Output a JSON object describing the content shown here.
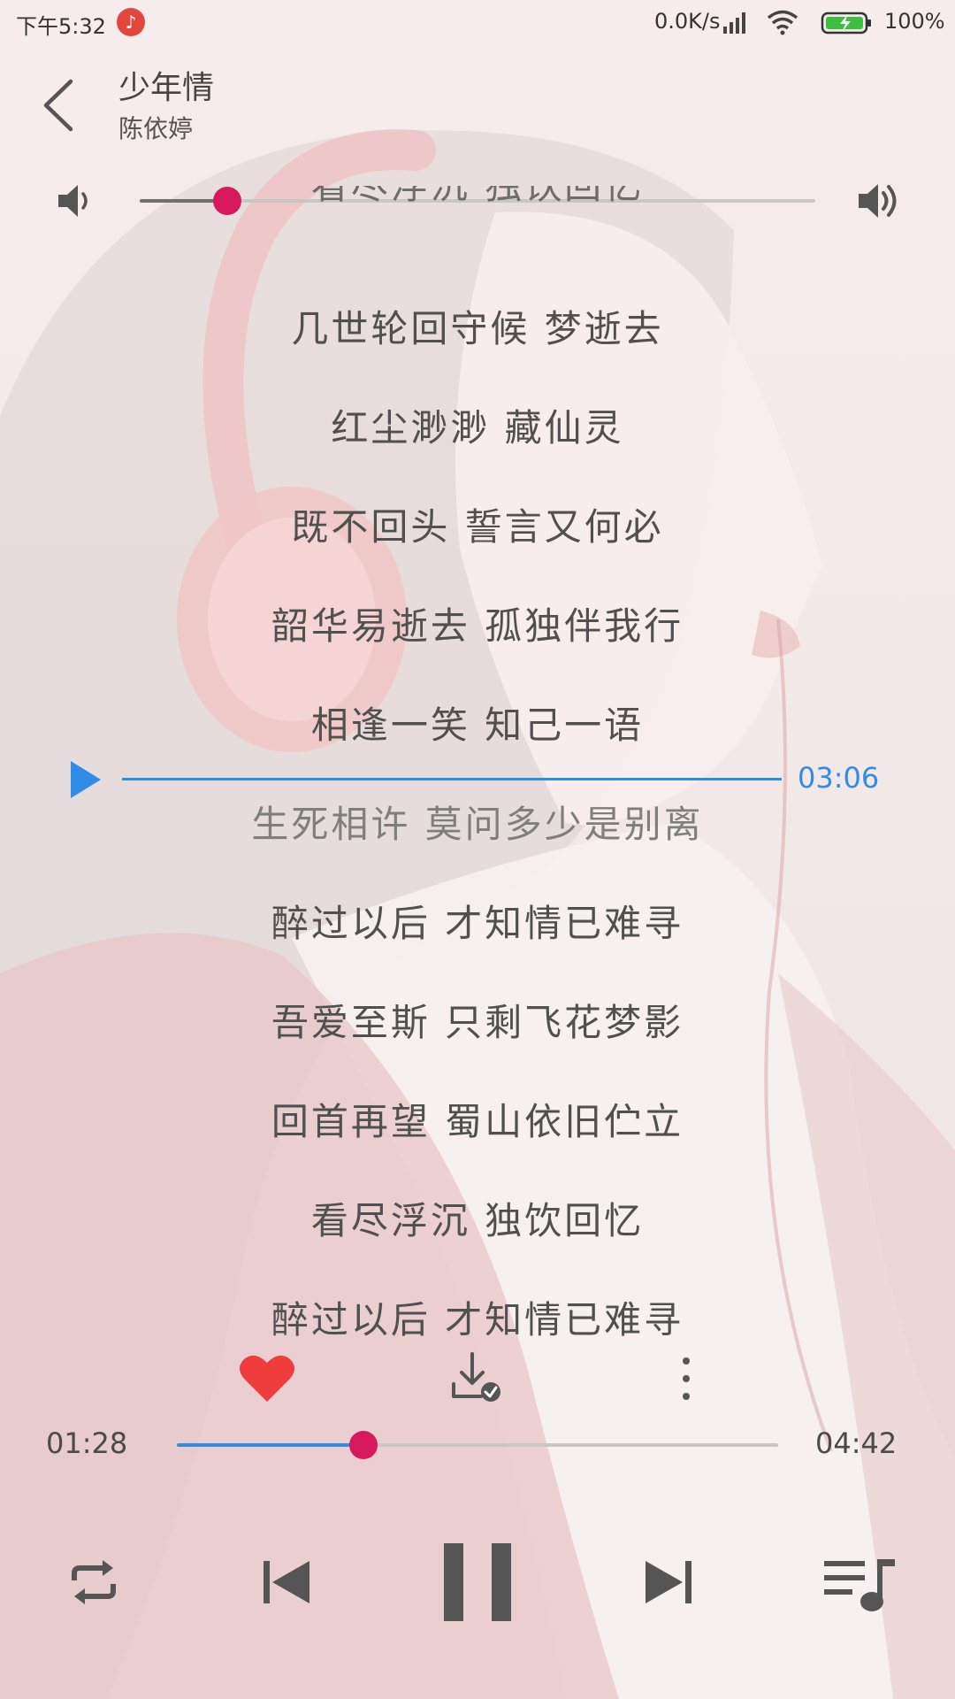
{
  "status_bar": {
    "time": "下午5:32",
    "app_icon": "music-note-icon",
    "net_speed": "0.0K/s",
    "battery": "100%",
    "icons": [
      "signal-icon",
      "wifi-icon",
      "battery-charging-icon"
    ]
  },
  "header": {
    "title": "少年情",
    "artist": "陈依婷"
  },
  "volume": {
    "level": 0.13
  },
  "lyrics": {
    "lines": [
      "看尽浮沉 独饮回忆",
      "几世轮回守候 梦逝去",
      "红尘渺渺 藏仙灵",
      "既不回头 誓言又何必",
      "韶华易逝去 孤独伴我行",
      "相逢一笑 知己一语",
      "生死相许 莫问多少是别离",
      "醉过以后 才知情已难寻",
      "吾爱至斯 只剩飞花梦影",
      "回首再望 蜀山依旧伫立",
      "看尽浮沉 独饮回忆",
      "醉过以后 才知情已难寻"
    ],
    "current_index": 6
  },
  "seek_indicator": {
    "time": "03:06"
  },
  "progress": {
    "elapsed": "01:28",
    "total": "04:42",
    "fraction": 0.31
  },
  "colors": {
    "accent_blue": "#2f8de8",
    "thumb_pink": "#d8185c",
    "heart_red": "#ef3d3d",
    "icon_gray": "#555555"
  },
  "icons": {
    "back": "back-arrow-icon",
    "volume_low": "volume-low-icon",
    "volume_high": "volume-high-icon",
    "seek_play": "play-icon",
    "favorite": "heart-icon",
    "download": "downloaded-icon",
    "more": "more-vertical-icon",
    "repeat": "repeat-icon",
    "previous": "skip-previous-icon",
    "pause": "pause-icon",
    "next": "skip-next-icon",
    "playlist": "playlist-icon"
  }
}
